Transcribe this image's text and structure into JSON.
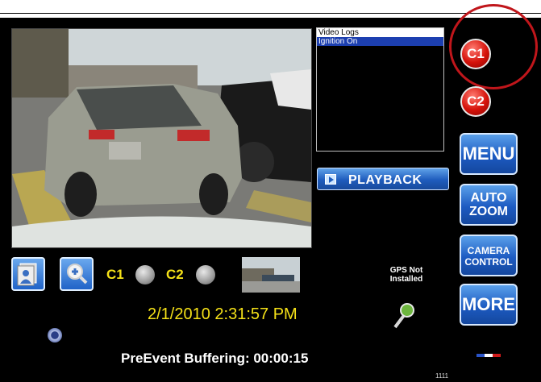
{
  "log_panel": {
    "header": "Video Logs",
    "items": [
      "Ignition On"
    ]
  },
  "playback": {
    "label": "PLAYBACK"
  },
  "camera_buttons": {
    "c1": "C1",
    "c2": "C2"
  },
  "side_menu": {
    "menu": "MENU",
    "auto_zoom": [
      "AUTO",
      "ZOOM"
    ],
    "camera_control": [
      "CAMERA",
      "CONTROL"
    ],
    "more": "MORE"
  },
  "bottom_bar": {
    "c1_label": "C1",
    "c2_label": "C2",
    "gps_status": [
      "GPS Not",
      "Installed"
    ],
    "datetime": "2/1/2010 2:31:57 PM",
    "buffer_status": "PreEvent Buffering: 00:00:15",
    "counter": "1111"
  },
  "icons": [
    "photo-album-icon",
    "zoom-in-icon",
    "microphone-icon",
    "record-status-icon",
    "play-icon",
    "flag-icon"
  ],
  "colors": {
    "accent_blue": "#1f5cbd",
    "accent_red": "#d5120a",
    "text_yellow": "#f5e118"
  }
}
